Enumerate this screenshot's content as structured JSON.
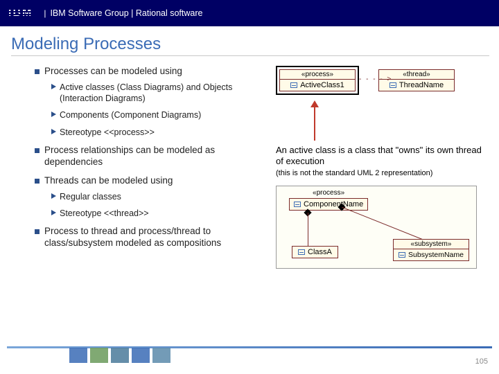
{
  "header": {
    "logo_text": "IBM",
    "group": "IBM Software Group | Rational software"
  },
  "title": "Modeling Processes",
  "bullets": {
    "b1": "Processes can be modeled using",
    "b1a": "Active classes (Class Diagrams) and Objects (Interaction Diagrams)",
    "b1b": "Components (Component Diagrams)",
    "b1c": "Stereotype <<process>>",
    "b2": "Process relationships can be modeled as dependencies",
    "b3": "Threads can be modeled using",
    "b3a": "Regular classes",
    "b3b": "Stereotype <<thread>>",
    "b4": "Process to thread and process/thread to class/subsystem modeled as compositions"
  },
  "diagram1": {
    "process_stereotype": "«process»",
    "active_class": "ActiveClass1",
    "thread_stereotype": "«thread»",
    "thread_name": "ThreadName",
    "connector": "- - - - >"
  },
  "caption": {
    "main": "An active class is a class that \"owns\" its own thread of execution",
    "note": "(this is not the standard UML 2 representation)"
  },
  "diagram2": {
    "process_stereotype": "«process»",
    "component_name": "ComponentName",
    "class_a": "ClassA",
    "subsys_stereotype": "«subsystem»",
    "subsys_name": "SubsystemName"
  },
  "page_number": "105"
}
